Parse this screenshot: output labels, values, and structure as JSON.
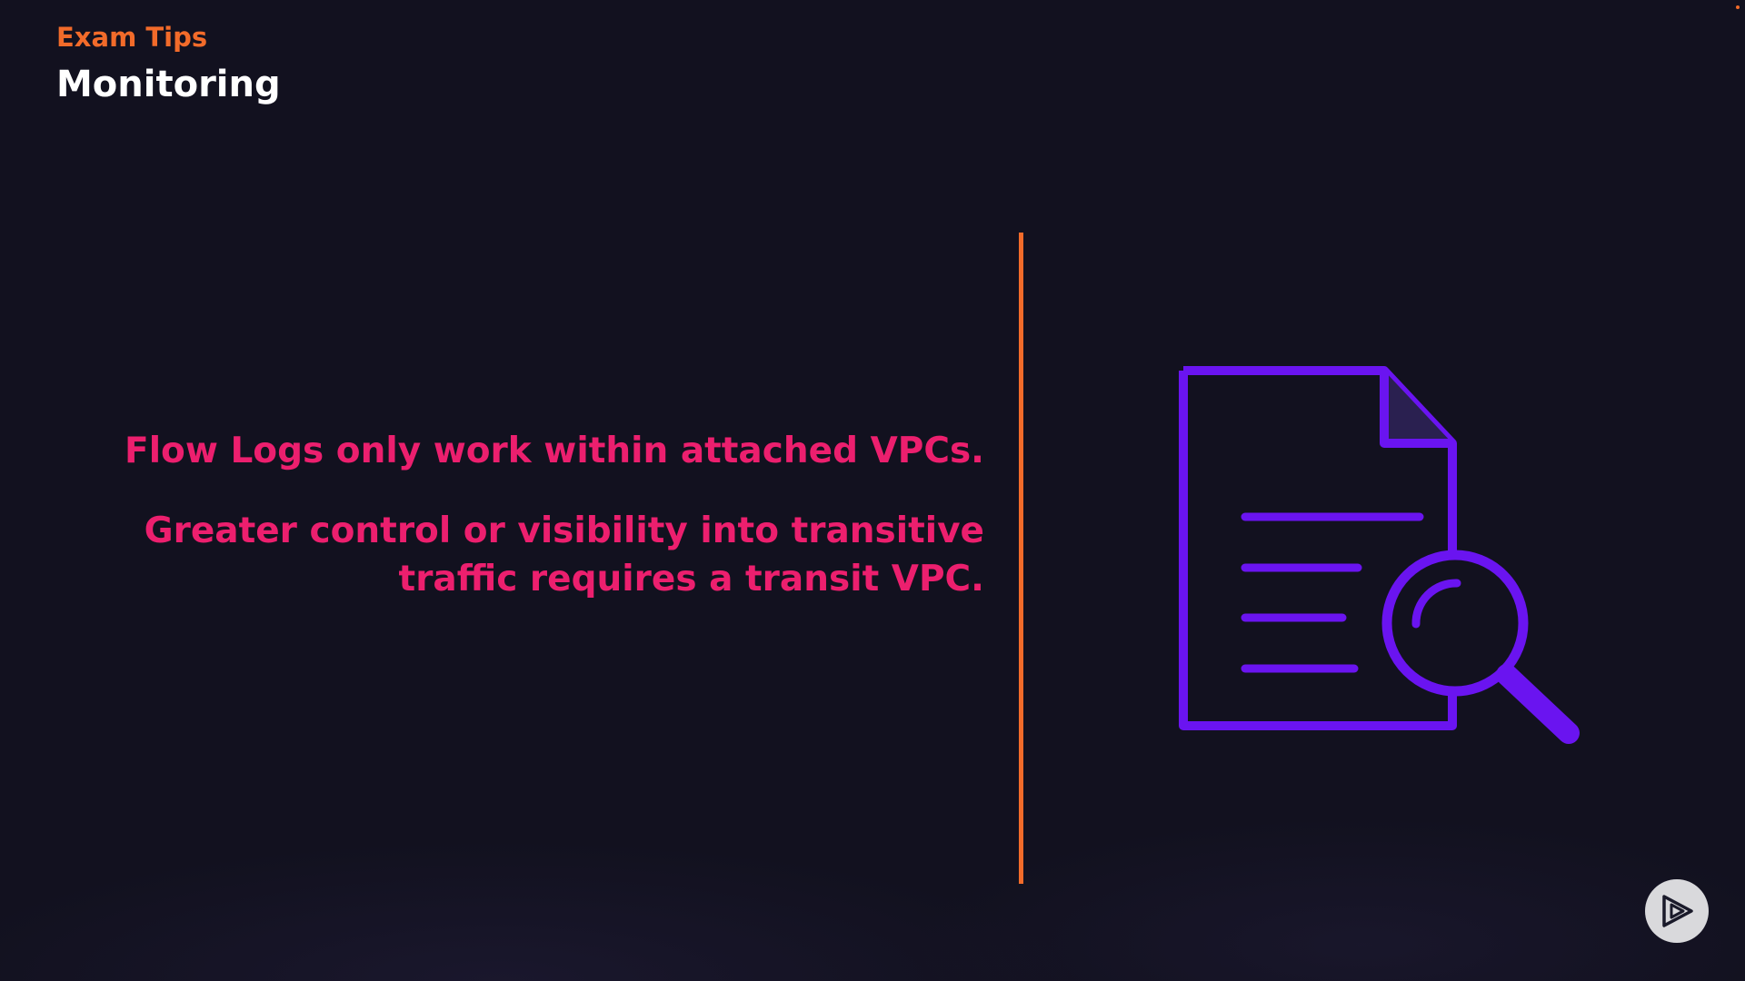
{
  "header": {
    "section": "Exam Tips",
    "title": "Monitoring"
  },
  "tips": [
    "Flow Logs only work within attached VPCs.",
    "Greater control or visibility into transitive traffic requires a transit VPC."
  ],
  "illustration": {
    "icon": "document-search-icon"
  },
  "player": {
    "icon": "play-logo-icon"
  },
  "colors": {
    "background": "#12111f",
    "accent_orange": "#f26b2a",
    "tip_pink": "#ec1f6e",
    "icon_purple": "#6a14f0",
    "title_white": "#ffffff"
  }
}
